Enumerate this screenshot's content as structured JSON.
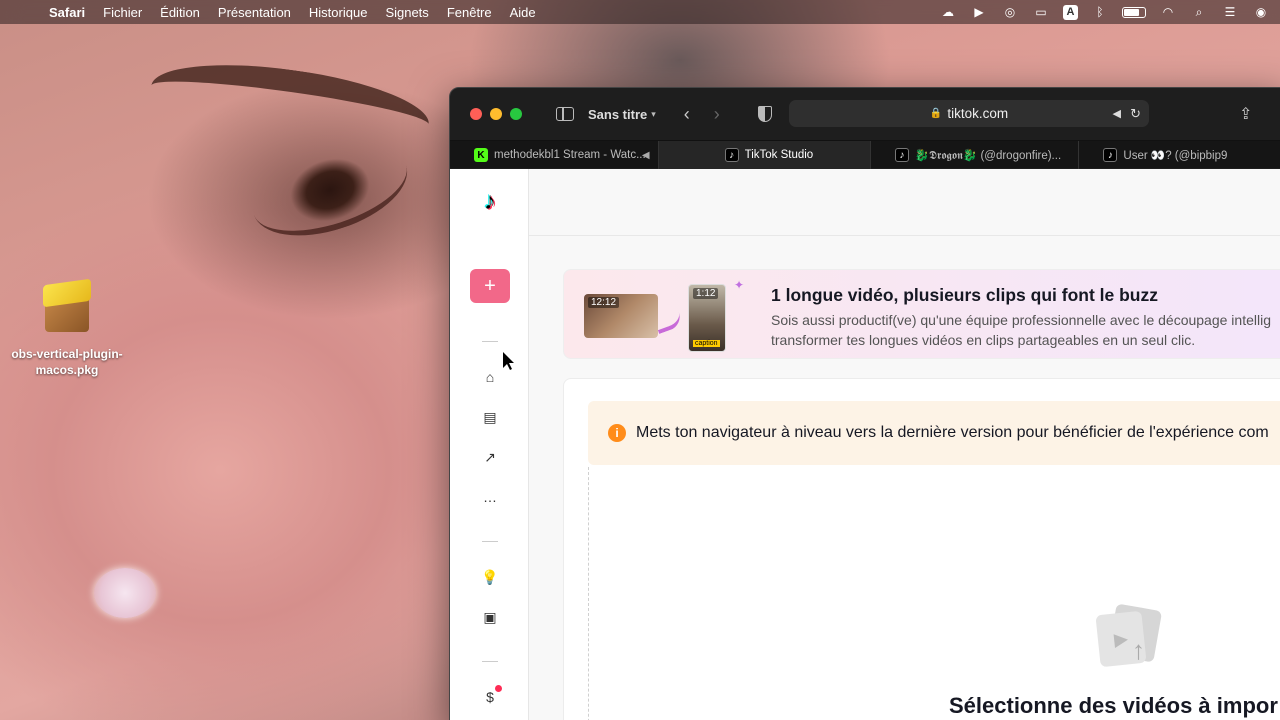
{
  "menubar": {
    "app_name": "Safari",
    "items": [
      "Fichier",
      "Édition",
      "Présentation",
      "Historique",
      "Signets",
      "Fenêtre",
      "Aide"
    ],
    "status_icons": [
      "creative-cloud-icon",
      "play-icon",
      "airdrop-icon",
      "screen-mirroring-icon",
      "input-source-icon",
      "bluetooth-icon",
      "battery-icon",
      "wifi-icon",
      "search-icon",
      "control-center-icon",
      "siri-icon"
    ],
    "input_source_label": "A"
  },
  "desktop": {
    "file_icon": "package-icon",
    "file_name": "obs-vertical-plugin-macos.pkg"
  },
  "safari": {
    "tab_group": "Sans titre",
    "url": "tiktok.com",
    "tabs": [
      {
        "title": "methodekbl1 Stream - Watc...",
        "favicon": "kick-icon",
        "muted": true
      },
      {
        "title": "TikTok Studio",
        "favicon": "tiktok-icon",
        "active": true
      },
      {
        "title": "🐉𝕯𝖗𝖔𝖌𝖔𝖓🐉 (@drogonfire)...",
        "favicon": "tiktok-icon"
      },
      {
        "title": "User 👀? (@bipbip9",
        "favicon": "tiktok-icon"
      }
    ]
  },
  "studio": {
    "upload_label": "+",
    "nav_icons": [
      "home-icon",
      "posts-icon",
      "analytics-icon",
      "comments-icon",
      "inspiration-icon",
      "academy-icon",
      "monetization-icon"
    ],
    "banner": {
      "thumb1_time": "12:12",
      "thumb2_time": "1:12",
      "thumb2_caption": "caption",
      "title": "1 longue vidéo, plusieurs clips qui font le buzz",
      "line1": "Sois aussi productif(ve) qu'une équipe professionnelle avec le découpage intellig",
      "line2": "transformer tes longues vidéos en clips partageables en un seul clic."
    },
    "notice": "Mets ton navigateur à niveau vers la dernière version pour bénéficier de l'expérience com",
    "select_title": "Sélectionne des vidéos à impor"
  }
}
